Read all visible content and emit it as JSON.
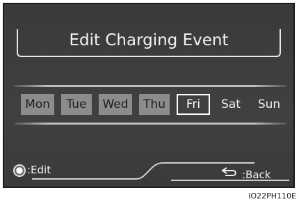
{
  "header": {
    "title": "Edit Charging Event"
  },
  "days": [
    {
      "label": "Mon",
      "state": "shaded"
    },
    {
      "label": "Tue",
      "state": "shaded"
    },
    {
      "label": "Wed",
      "state": "shaded"
    },
    {
      "label": "Thu",
      "state": "shaded"
    },
    {
      "label": "Fri",
      "state": "selected"
    },
    {
      "label": "Sat",
      "state": "plain"
    },
    {
      "label": "Sun",
      "state": "plain"
    }
  ],
  "footer": {
    "edit_icon": "dial-knob-icon",
    "edit_label": ":Edit",
    "back_icon": "return-arrow-icon",
    "back_label": ":Back"
  },
  "image_code": "IO22PH110E"
}
